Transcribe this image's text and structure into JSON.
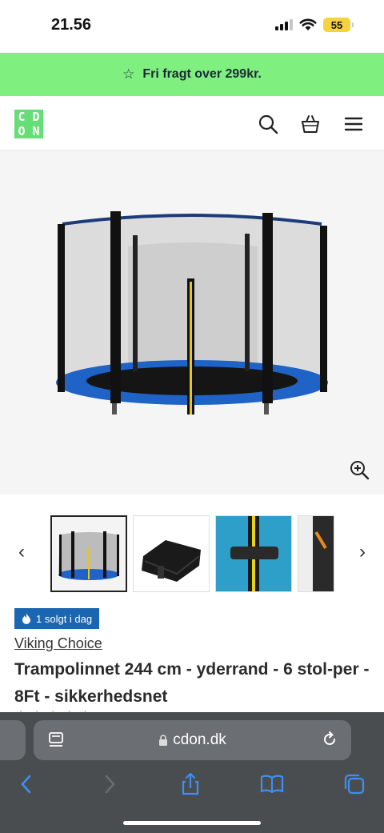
{
  "status": {
    "time": "21.56",
    "battery": "55"
  },
  "promo": {
    "icon": "star-icon",
    "text": "Fri fragt over 299kr."
  },
  "header": {
    "logo_letters": [
      "C",
      "D",
      "O",
      "N"
    ],
    "icons": [
      "search-icon",
      "basket-icon",
      "menu-icon"
    ]
  },
  "product": {
    "sold_badge": "1 solgt i dag",
    "brand": "Viking Choice",
    "title": "Trampolinnet 244 cm - yderrand - 6 stol-per - 8Ft - sikkerhedsnet"
  },
  "browser": {
    "url": "cdon.dk"
  },
  "colors": {
    "promo_bg": "#7ff07f",
    "logo_bg": "#66dd77",
    "badge_bg": "#1b66b0",
    "browser_bar": "#4a4d50"
  }
}
